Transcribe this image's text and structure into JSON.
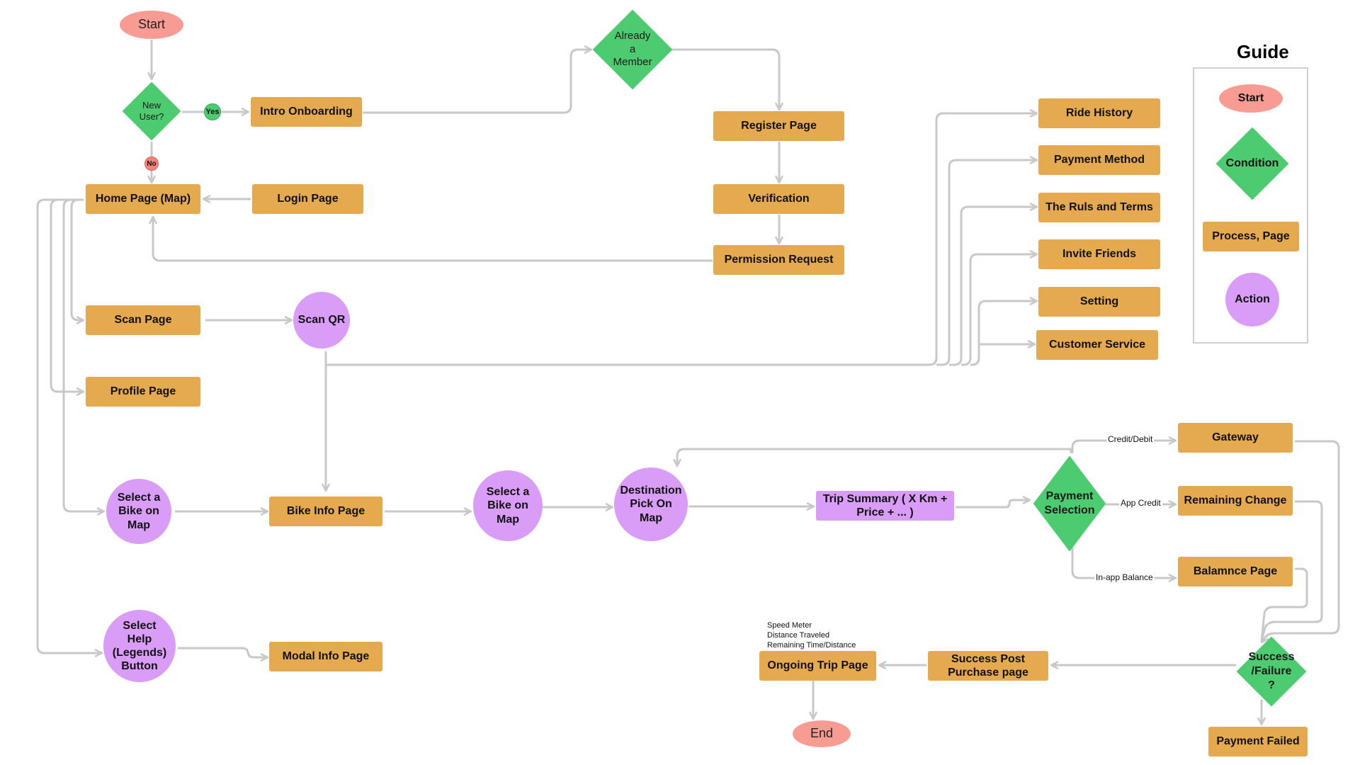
{
  "colors": {
    "process": "#e5a94f",
    "condition": "#4ccb70",
    "action": "#d99cf7",
    "terminal": "#f79b93",
    "connector": "#c8c8c8"
  },
  "nodes": {
    "start": "Start",
    "end": "End",
    "new_user": "New\nUser?",
    "yes": "Yes",
    "no": "No",
    "intro_onboarding": "Intro Onboarding",
    "already_member": "Already\na\nMember",
    "register_page": "Register Page",
    "verification": "Verification",
    "permission_request": "Permission Request",
    "home_page": "Home Page (Map)",
    "login_page": "Login Page",
    "scan_page": "Scan Page",
    "scan_qr": "Scan QR",
    "profile_page": "Profile Page",
    "select_bike_1": "Select a\nBike on\nMap",
    "bike_info_page": "Bike Info Page",
    "select_bike_2": "Select a\nBike on\nMap",
    "destination": "Destination\nPick On\nMap",
    "trip_summary": "Trip Summary ( X Km +\nPrice + ... )",
    "payment_selection": "Payment\nSelection",
    "gateway": "Gateway",
    "remaining_change": "Remaining Change",
    "balance_page": "Balamnce Page",
    "success_failure": "Success\n/Failure\n?",
    "payment_failed": "Payment Failed",
    "success_post": "Success Post\nPurchase page",
    "ongoing_trip": "Ongoing Trip Page",
    "select_help": "Select\nHelp\n(Legends)\nButton",
    "modal_info": "Modal Info Page",
    "ride_history": "Ride History",
    "payment_method": "Payment Method",
    "rules_terms": "The Ruls and Terms",
    "invite_friends": "Invite Friends",
    "setting": "Setting",
    "customer_service": "Customer Service"
  },
  "edge_labels": {
    "credit_debit": "Credit/Debit",
    "app_credit": "App Credit",
    "in_app_balance": "In-app Balance"
  },
  "ongoing_trip_note": "Speed Meter\nDistance Traveled\nRemaining Time/Distance",
  "guide": {
    "title": "Guide",
    "start": "Start",
    "condition": "Condition",
    "process": "Process, Page",
    "action": "Action"
  }
}
